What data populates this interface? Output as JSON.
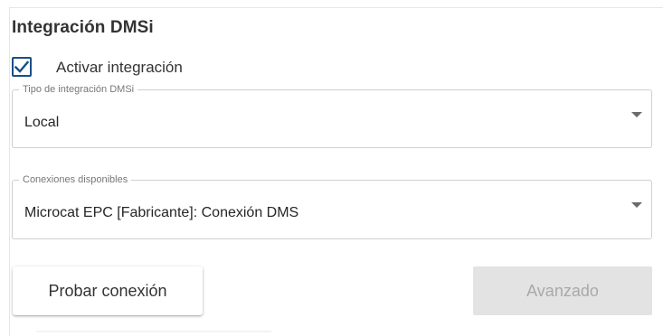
{
  "section": {
    "title": "Integración DMSi"
  },
  "activate": {
    "label": "Activar integración",
    "checked": true,
    "check_color": "#1a4f8b"
  },
  "integration_type": {
    "legend": "Tipo de integración DMSi",
    "value": "Local"
  },
  "connections": {
    "legend": "Conexiones disponibles",
    "value": "Microcat EPC [Fabricante]: Conexión DMS"
  },
  "buttons": {
    "test_label": "Probar conexión",
    "advanced_label": "Avanzado",
    "advanced_disabled": true
  },
  "icons": {
    "checkbox": "checkmark-icon",
    "dropdown": "caret-down-icon"
  }
}
